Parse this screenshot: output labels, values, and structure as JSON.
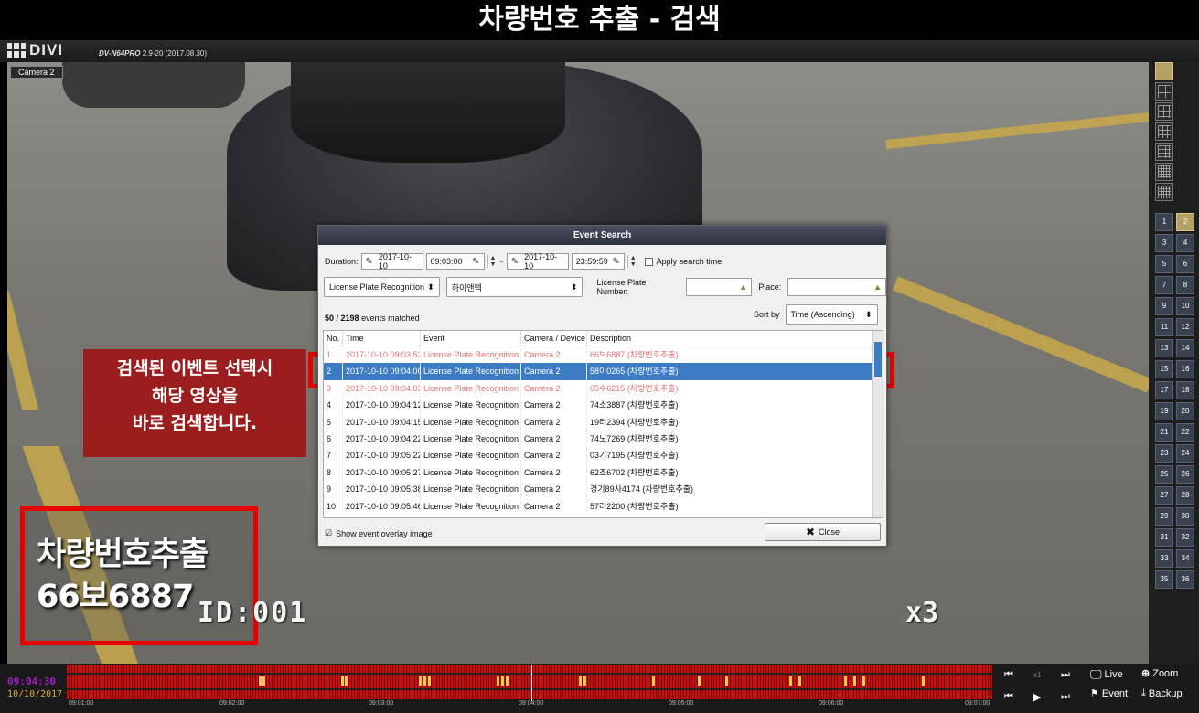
{
  "banner": {
    "title": "차량번호 추출 - 검색"
  },
  "app": {
    "logo": "DIVI",
    "model": "DV-N64PRO",
    "version": "2.9-20 (2017.08.30)"
  },
  "camera": {
    "label": "Camera 2",
    "osd_id": "ID:001",
    "osd_speed": "x3"
  },
  "plate_overlay": {
    "line1": "차량번호추출",
    "line2": "66보6887"
  },
  "callout": {
    "line1": "검색된 이벤트 선택시",
    "line2": "해당 영상을",
    "line3": "바로 검색합니다."
  },
  "dialog": {
    "title": "Event Search",
    "duration_label": "Duration:",
    "start_date": "2017-10-10",
    "start_time": "09:03:00",
    "end_date": "2017-10-10",
    "end_time": "23:59:59",
    "tilde": "~",
    "apply_search_time": "Apply search time",
    "event_type": "License Plate Recognition",
    "device": "하이앤텍",
    "plate_number_label": "License Plate Number:",
    "place_label": "Place:",
    "matched_count": "50 / 2198",
    "matched_text": "events matched",
    "sort_label": "Sort by",
    "sort_value": "Time (Ascending)",
    "columns": [
      "No.",
      "Time",
      "Event",
      "Camera / Device",
      "Description"
    ],
    "rows": [
      [
        "1",
        "2017-10-10 09:03:52",
        "License Plate Recognition",
        "Camera 2",
        "66보6887 (차량번호추출)"
      ],
      [
        "2",
        "2017-10-10 09:04:00",
        "License Plate Recognition",
        "Camera 2",
        "58이0265 (차량번호추출)"
      ],
      [
        "3",
        "2017-10-10 09:04:03",
        "License Plate Recognition",
        "Camera 2",
        "65수6215 (차량번호추출)"
      ],
      [
        "4",
        "2017-10-10 09:04:12",
        "License Plate Recognition",
        "Camera 2",
        "74소3887 (차량번호추출)"
      ],
      [
        "5",
        "2017-10-10 09:04:15",
        "License Plate Recognition",
        "Camera 2",
        "19러2394 (차량번호추출)"
      ],
      [
        "6",
        "2017-10-10 09:04:22",
        "License Plate Recognition",
        "Camera 2",
        "74노7269 (차량번호추출)"
      ],
      [
        "7",
        "2017-10-10 09:05:22",
        "License Plate Recognition",
        "Camera 2",
        "03기7195 (차량번호추출)"
      ],
      [
        "8",
        "2017-10-10 09:05:27",
        "License Plate Recognition",
        "Camera 2",
        "62조6702 (차량번호추출)"
      ],
      [
        "9",
        "2017-10-10 09:05:38",
        "License Plate Recognition",
        "Camera 2",
        "경기89사4174 (차량번호추출)"
      ],
      [
        "10",
        "2017-10-10 09:05:46",
        "License Plate Recognition",
        "Camera 2",
        "57러2200 (차량번호추출)"
      ]
    ],
    "selected_row": 2,
    "show_overlay": "Show event overlay image",
    "close": "Close"
  },
  "channels": [
    "1",
    "2",
    "3",
    "4",
    "5",
    "6",
    "7",
    "8",
    "9",
    "10",
    "11",
    "12",
    "13",
    "14",
    "15",
    "16",
    "17",
    "18",
    "19",
    "20",
    "21",
    "22",
    "23",
    "24",
    "25",
    "26",
    "27",
    "28",
    "29",
    "30",
    "31",
    "32",
    "33",
    "34",
    "35",
    "36"
  ],
  "selected_channel": "2",
  "timeline": {
    "current_time": "09:04:30",
    "current_date": "10/10/2017",
    "labels": [
      "09:01:00",
      "09:02:00",
      "09:03:00",
      "09:04:00",
      "09:05:00",
      "09:06:00",
      "09:07:00"
    ],
    "speed": "x1"
  },
  "controls": {
    "live": "Live",
    "zoom": "Zoom",
    "event": "Event",
    "backup": "Backup"
  },
  "colors": {
    "highlight": "#e60000",
    "selection": "#3d7cc5",
    "callout_bg": "#a01414",
    "channel_selected": "#b5a067"
  }
}
